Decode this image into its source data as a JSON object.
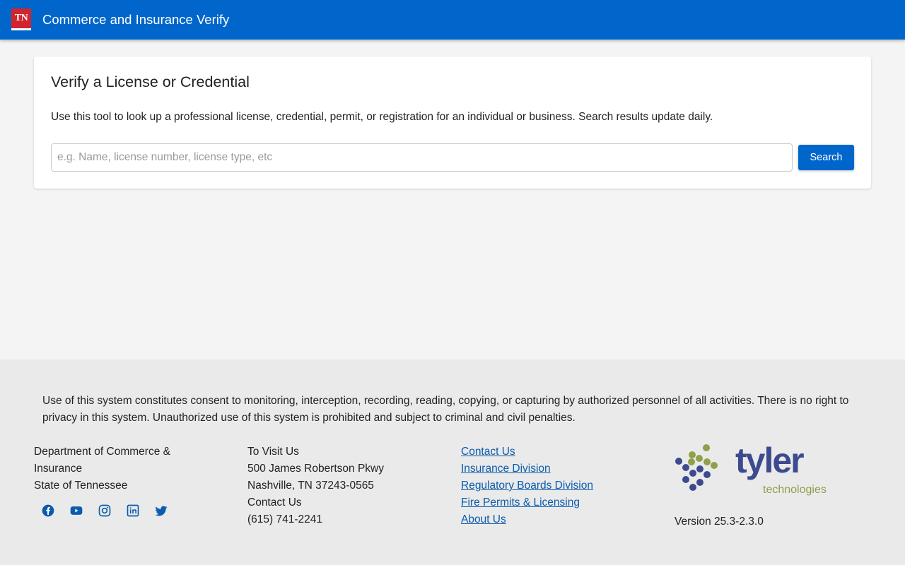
{
  "header": {
    "logo_text": "TN",
    "title": "Commerce and Insurance Verify",
    "bg_color": "#0066cc"
  },
  "verify_card": {
    "title": "Verify a License or Credential",
    "description": "Use this tool to look up a professional license, credential, permit, or registration for an individual or business. Search results update daily.",
    "search_value": "",
    "search_placeholder": "e.g. Name, license number, license type, etc",
    "search_button_label": "Search"
  },
  "footer": {
    "disclaimer": "Use of this system constitutes consent to monitoring, interception, recording, reading, copying, or capturing by authorized personnel of all activities. There is no right to privacy in this system. Unauthorized use of this system is prohibited and subject to criminal and civil penalties.",
    "org": {
      "line1": "Department of Commerce & Insurance",
      "line2": "State of Tennessee"
    },
    "socials": [
      {
        "icon": "facebook-icon"
      },
      {
        "icon": "youtube-icon"
      },
      {
        "icon": "instagram-icon"
      },
      {
        "icon": "linkedin-icon"
      },
      {
        "icon": "twitter-icon"
      }
    ],
    "visit": {
      "heading": "To Visit Us",
      "address1": "500 James Robertson Pkwy",
      "address2": "Nashville, TN 37243-0565",
      "contact_heading": "Contact Us",
      "phone": "(615) 741-2241"
    },
    "links": [
      {
        "label": "Contact Us"
      },
      {
        "label": "Insurance Division"
      },
      {
        "label": "Regulatory Boards Division"
      },
      {
        "label": "Fire Permits & Licensing"
      },
      {
        "label": "About Us"
      }
    ],
    "vendor_logo": {
      "name": "tyler",
      "tagline": "technologies"
    },
    "version": "Version 25.3-2.3.0"
  }
}
